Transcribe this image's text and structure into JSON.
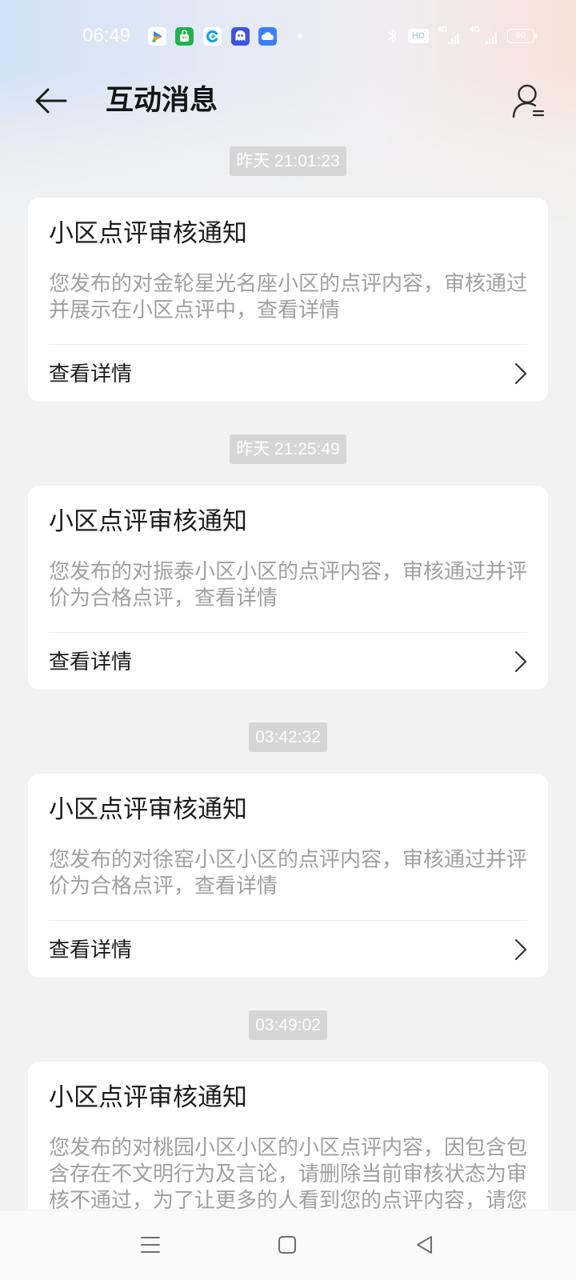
{
  "theme": {
    "page_bg": "#f2f2f2",
    "card_bg": "#ffffff",
    "timestamp_badge_bg": "#d6d6d6",
    "title_text": "#1c1c1c",
    "body_text": "#a0a0a0"
  },
  "status_bar": {
    "time": "06:49",
    "notification_icons": [
      "video-app-icon",
      "green-app-icon",
      "browser-app-icon",
      "chat-app-icon",
      "cloud-app-icon",
      "more-notifications-dot"
    ],
    "system_icons": [
      "bluetooth-icon",
      "hd-voice-icon",
      "signal-icon",
      "signal-icon",
      "battery-icon"
    ],
    "hd_label": "HD",
    "signal_1_label": "4G",
    "signal_2_label": "4G",
    "battery_level": "60"
  },
  "header": {
    "back_icon": "arrow-left-icon",
    "title": "互动消息",
    "profile_icon": "user-menu-icon"
  },
  "messages": [
    {
      "timestamp": "昨天 21:01:23",
      "title": "小区点评审核通知",
      "body": "您发布的对金轮星光名座小区的点评内容，审核通过并展示在小区点评中，查看详情",
      "action": "查看详情"
    },
    {
      "timestamp": "昨天 21:25:49",
      "title": "小区点评审核通知",
      "body": "您发布的对振泰小区小区的点评内容，审核通过并评价为合格点评，查看详情",
      "action": "查看详情"
    },
    {
      "timestamp": "03:42:32",
      "title": "小区点评审核通知",
      "body": "您发布的对徐窑小区小区的点评内容，审核通过并评价为合格点评，查看详情",
      "action": "查看详情"
    },
    {
      "timestamp": "03:49:02",
      "title": "小区点评审核通知",
      "body": "您发布的对桃园小区小区的小区点评内容，因包含包含存在不文明行为及言论，请删除当前审核状态为审核不通过，为了让更多的人看到您的点评内容，请您"
    }
  ],
  "nav_bar": {
    "icons": [
      "menu-icon",
      "home-icon",
      "back-triangle-icon"
    ]
  }
}
